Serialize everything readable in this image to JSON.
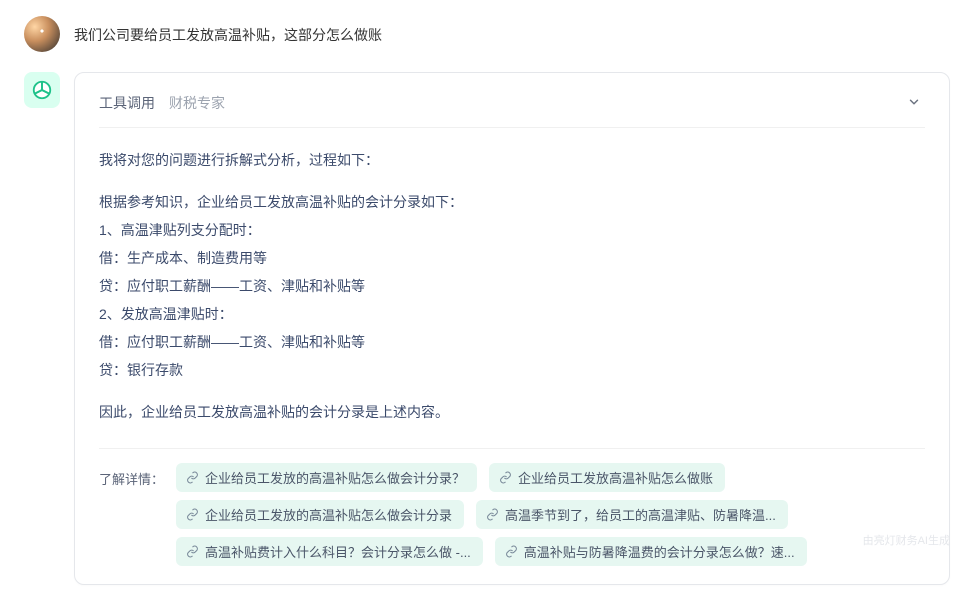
{
  "user": {
    "question": "我们公司要给员工发放高温补贴，这部分怎么做账"
  },
  "tool": {
    "label": "工具调用",
    "name": "财税专家"
  },
  "answer": {
    "intro": "我将对您的问题进行拆解式分析，过程如下：",
    "lines": [
      "根据参考知识，企业给员工发放高温补贴的会计分录如下：",
      "1、高温津贴列支分配时：",
      "借：生产成本、制造费用等",
      "贷：应付职工薪酬——工资、津贴和补贴等",
      "2、发放高温津贴时：",
      "借：应付职工薪酬——工资、津贴和补贴等",
      "贷：银行存款"
    ],
    "conclusion": "因此，企业给员工发放高温补贴的会计分录是上述内容。"
  },
  "related": {
    "label": "了解详情：",
    "links": [
      "企业给员工发放的高温补贴怎么做会计分录？",
      "企业给员工发放高温补贴怎么做账",
      "企业给员工发放的高温补贴怎么做会计分录",
      "高温季节到了，给员工的高温津贴、防暑降温...",
      "高温补贴费计入什么科目？会计分录怎么做 -...",
      "高温补贴与防暑降温费的会计分录怎么做？速..."
    ]
  },
  "watermark": "由亮灯财务AI生成"
}
